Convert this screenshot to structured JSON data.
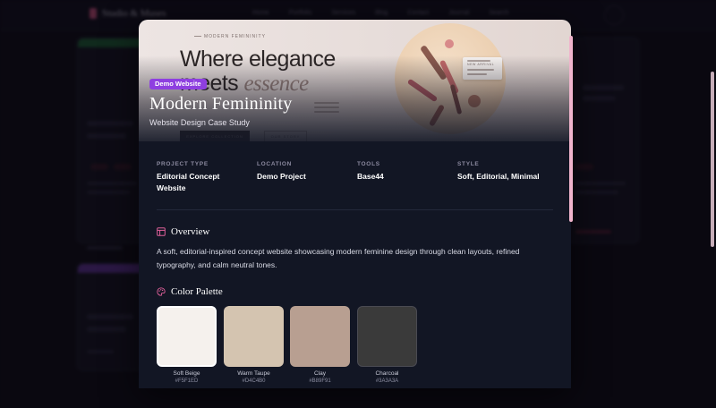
{
  "background": {
    "brand": "Studio & Muses",
    "nav": [
      "Home",
      "Portfolio",
      "Services",
      "Blog",
      "Contact",
      "Journal",
      "Search"
    ]
  },
  "hero": {
    "tag": "MODERN FEMININITY",
    "headline_line1": "Where elegance",
    "headline_line2_prefix": "meets ",
    "headline_line2_emph": "essence",
    "button_primary": "EXPLORE COLLECTION",
    "button_secondary": "OUR STORY",
    "card_label": "NEW ARRIVAL"
  },
  "modal": {
    "badge": "Demo Website",
    "title": "Modern Femininity",
    "subtitle": "Website Design Case Study",
    "meta": [
      {
        "label": "PROJECT TYPE",
        "value": "Editorial Concept Website"
      },
      {
        "label": "LOCATION",
        "value": "Demo Project"
      },
      {
        "label": "TOOLS",
        "value": "Base44"
      },
      {
        "label": "STYLE",
        "value": "Soft, Editorial, Minimal"
      }
    ],
    "overview": {
      "heading": "Overview",
      "text": "A soft, editorial-inspired concept website showcasing modern feminine design through clean layouts, refined typography, and calm neutral tones."
    },
    "palette": {
      "heading": "Color Palette",
      "colors": [
        {
          "name": "Soft Beige",
          "hex": "#F5F1ED"
        },
        {
          "name": "Warm Taupe",
          "hex": "#D4C4B0"
        },
        {
          "name": "Clay",
          "hex": "#B89F91"
        },
        {
          "name": "Charcoal",
          "hex": "#3A3A3A"
        }
      ]
    }
  },
  "colors": {
    "accent_purple": "#8e3fe0",
    "accent_pink": "#e05a8a",
    "modal_bg": "#121624"
  }
}
